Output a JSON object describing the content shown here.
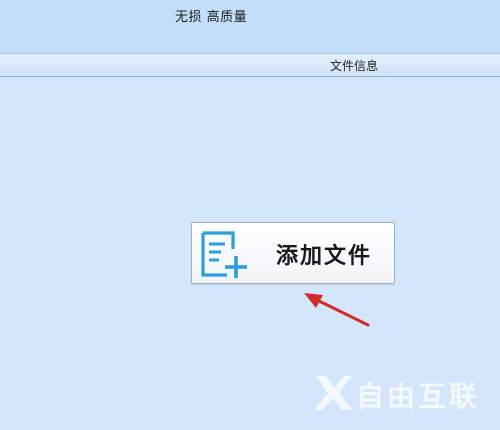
{
  "toolbar": {
    "quality_text": "无损 高质量"
  },
  "table_header": {
    "file_info": "文件信息"
  },
  "main": {
    "add_file_label": "添加文件",
    "add_file_icon": "add-file-icon"
  },
  "watermark": {
    "text": "自由互联"
  },
  "colors": {
    "background": "#d3e6fc",
    "icon_blue": "#2a9fd8",
    "arrow_red": "#d42a2a"
  }
}
